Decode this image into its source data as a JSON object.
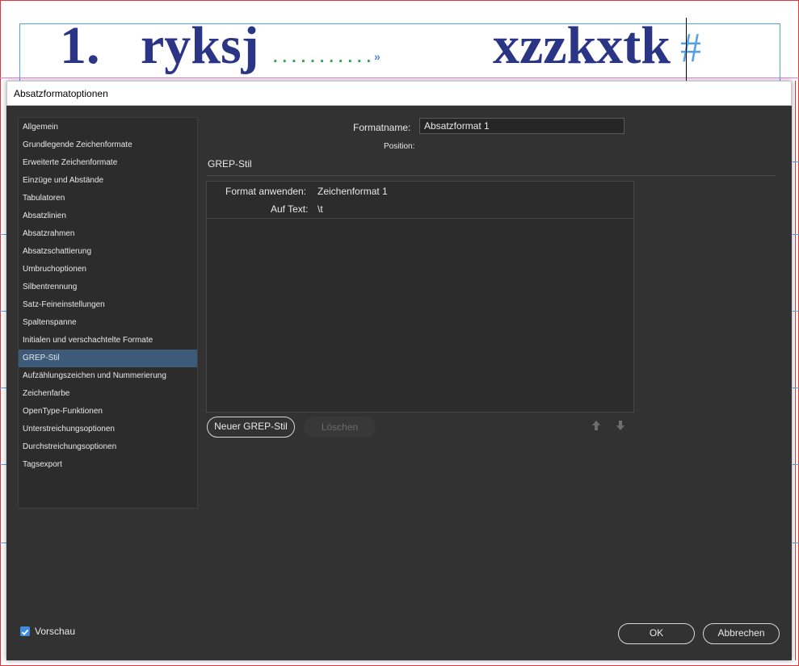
{
  "document": {
    "number": "1.",
    "word1": "ryksj",
    "dots": "...........",
    "tab_mark": "»",
    "word2": "xzzkxtk",
    "hash": "#"
  },
  "dialog": {
    "title": "Absatzformatoptionen",
    "nav": {
      "items": [
        "Allgemein",
        "Grundlegende Zeichenformate",
        "Erweiterte Zeichenformate",
        "Einzüge und Abstände",
        "Tabulatoren",
        "Absatzlinien",
        "Absatzrahmen",
        "Absatzschattierung",
        "Umbruchoptionen",
        "Silbentrennung",
        "Satz-Feineinstellungen",
        "Spaltenspanne",
        "Initialen und verschachtelte Formate",
        "GREP-Stil",
        "Aufzählungszeichen und Nummerierung",
        "Zeichenfarbe",
        "OpenType-Funktionen",
        "Unterstreichungsoptionen",
        "Durchstreichungsoptionen",
        "Tagsexport"
      ],
      "selected": "GREP-Stil"
    },
    "formatname_label": "Formatname:",
    "formatname_value": "Absatzformat 1",
    "position_label": "Position:",
    "section_title": "GREP-Stil",
    "grep": {
      "apply_label": "Format anwenden:",
      "apply_value": "Zeichenformat 1",
      "text_label": "Auf Text:",
      "text_value": "\\t"
    },
    "buttons": {
      "new_grep": "Neuer GREP-Stil",
      "delete": "Löschen",
      "ok": "OK",
      "cancel": "Abbrechen"
    },
    "preview_label": "Vorschau"
  }
}
